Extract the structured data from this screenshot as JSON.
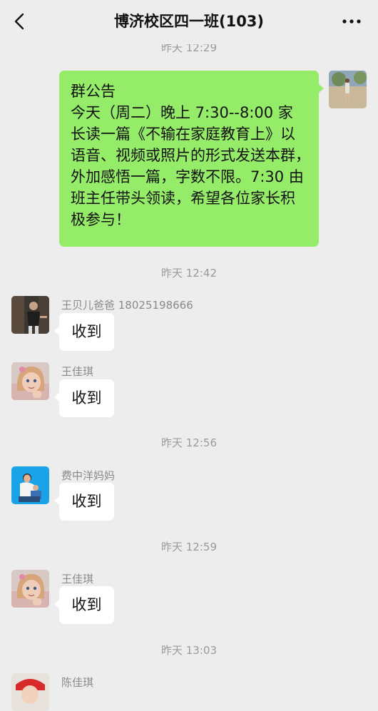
{
  "header": {
    "title": "博济校区四一班(103)"
  },
  "messages": {
    "peek_time": "昨天 12:29",
    "notice": {
      "lines": [
        "群公告",
        "今天（周二）晚上 7:30--8:00 家",
        "长读一篇《不输在家庭教育上》以",
        "语音、视频或照片的形式发送本群，",
        "外加感悟一篇，字数不限。7:30 由",
        "班主任带头领读，希望各位家长积",
        "极参与！"
      ]
    },
    "time_1242": "昨天 12:42",
    "m1": {
      "sender": "王贝儿爸爸 18025198666",
      "text": "收到"
    },
    "m2": {
      "sender": "王佳琪",
      "text": "收到"
    },
    "time_1256": "昨天 12:56",
    "m3": {
      "sender": "费中洋妈妈",
      "text": "收到"
    },
    "time_1259": "昨天 12:59",
    "m4": {
      "sender": "王佳琪",
      "text": "收到"
    },
    "time_1303": "昨天 13:03",
    "m5": {
      "sender": "陈佳琪"
    }
  },
  "colors": {
    "background": "#ededed",
    "my_bubble": "#95ec69",
    "their_bubble": "#ffffff",
    "meta_text": "#9a9a9a"
  },
  "icons": {
    "back": "chevron-left-icon",
    "more": "more-dots-icon"
  }
}
